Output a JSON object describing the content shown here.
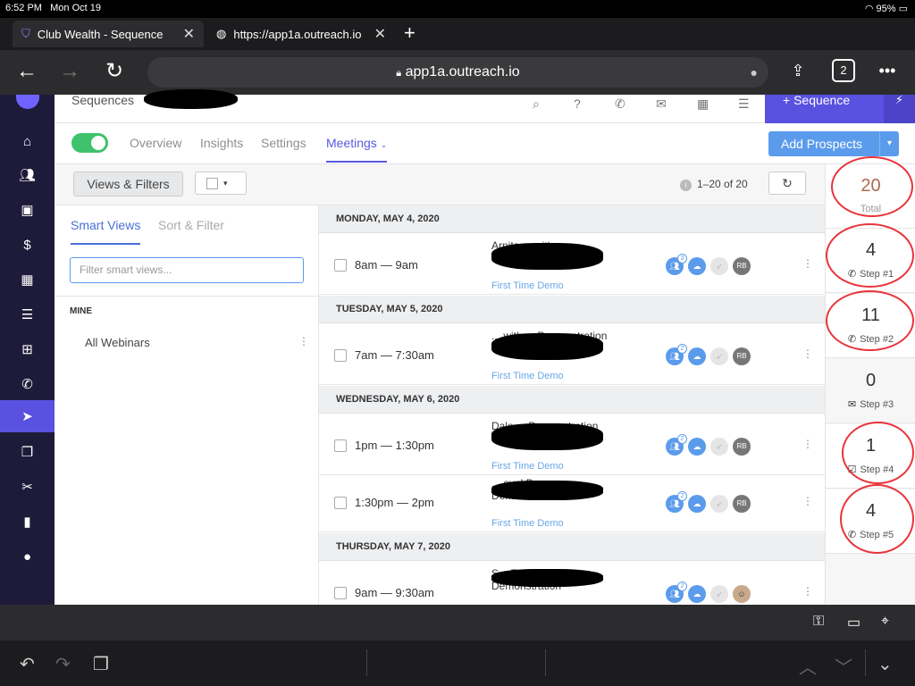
{
  "status_bar": {
    "time": "6:52 PM",
    "date": "Mon Oct 19",
    "battery": "95%"
  },
  "browser": {
    "tabs": [
      {
        "title": "Club Wealth - Sequence",
        "icon": "shield-icon",
        "active": true
      },
      {
        "title": "https://app1a.outreach.io",
        "icon": "globe-icon",
        "active": false
      }
    ],
    "url": "app1a.outreach.io",
    "tab_count": "2"
  },
  "topbar": {
    "breadcrumb": "Sequences",
    "add_sequence": "+ Sequence"
  },
  "nav_tabs": [
    "Overview",
    "Insights",
    "Settings",
    "Meetings"
  ],
  "active_tab": "Meetings",
  "add_prospects": "Add Prospects",
  "toolbar": {
    "views_filters": "Views & Filters",
    "pagination": "1–20 of 20"
  },
  "left_panel": {
    "tabs": [
      "Smart Views",
      "Sort & Filter"
    ],
    "filter_placeholder": "Filter smart views...",
    "section": "MINE",
    "items": [
      "All Webinars"
    ]
  },
  "meetings": {
    "days": [
      {
        "label": "MONDAY, MAY 4, 2020",
        "rows": [
          {
            "time": "8am — 9am",
            "title": "Arnita ... with ... Demonstration",
            "subtitle": "First Time Demo",
            "badge": "3",
            "owner": "RB"
          }
        ]
      },
      {
        "label": "TUESDAY, MAY 5, 2020",
        "rows": [
          {
            "time": "7am — 7:30am",
            "title": "... with ... Demonstration",
            "subtitle": "First Time Demo",
            "badge": "2",
            "owner": "RB"
          }
        ]
      },
      {
        "label": "WEDNESDAY, MAY 6, 2020",
        "rows": [
          {
            "time": "1pm — 1:30pm",
            "title": "Dale ... Demonstration",
            "subtitle": "First Time Demo",
            "badge": "2",
            "owner": "RB"
          },
          {
            "time": "1:30pm — 2pm",
            "title": "... oyal Ba... Demonstration",
            "subtitle": "First Time Demo",
            "badge": "2",
            "owner": "RB"
          }
        ]
      },
      {
        "label": "THURSDAY, MAY 7, 2020",
        "rows": [
          {
            "time": "9am — 9:30am",
            "title": "S... Zac Mull | ... Demonstration",
            "subtitle": "",
            "badge": "2",
            "owner": "avatar"
          }
        ]
      }
    ]
  },
  "steps_panel": {
    "total": {
      "value": "20",
      "label": "Total"
    },
    "steps": [
      {
        "value": "4",
        "label": "Step #1",
        "icon": "phone-icon"
      },
      {
        "value": "11",
        "label": "Step #2",
        "icon": "phone-icon"
      },
      {
        "value": "0",
        "label": "Step #3",
        "icon": "mail-icon"
      },
      {
        "value": "1",
        "label": "Step #4",
        "icon": "task-icon"
      },
      {
        "value": "4",
        "label": "Step #5",
        "icon": "phone-icon"
      }
    ]
  },
  "colors": {
    "accent": "#5951e0",
    "sidebar": "#1e1b3a",
    "link": "#5b9bec",
    "toggle_on": "#3ec26b",
    "annotation": "#e8343a"
  }
}
